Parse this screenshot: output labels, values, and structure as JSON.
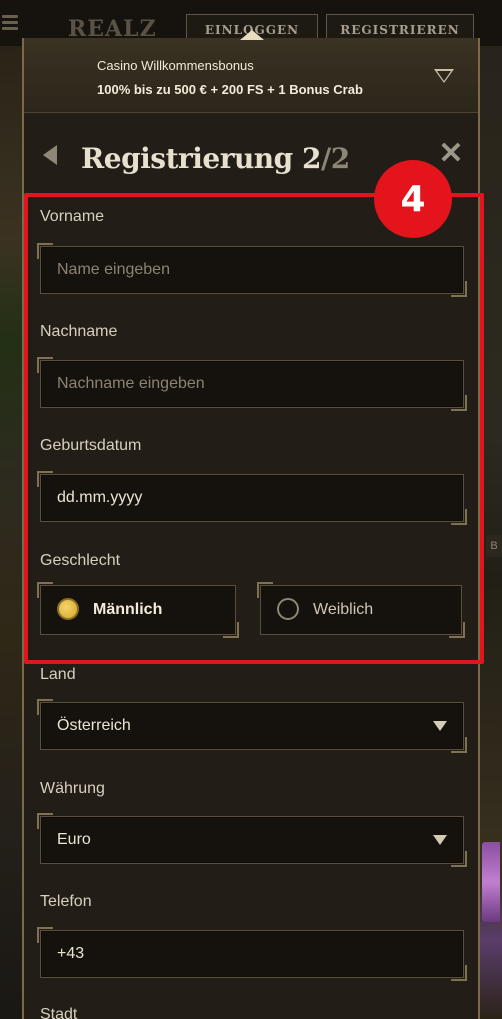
{
  "background": {
    "logo_text": "REALZ",
    "login_label": "EINLOGGEN",
    "register_label": "REGISTRIEREN",
    "right_tag": "B"
  },
  "bonus": {
    "title": "Casino Willkommensbonus",
    "text": "100% bis zu 500 € + 200 FS + 1 Bonus Crab"
  },
  "header": {
    "title": "Registrierung 2",
    "title_total": "/2"
  },
  "form": {
    "vorname": {
      "label": "Vorname",
      "placeholder": "Name eingeben"
    },
    "nachname": {
      "label": "Nachname",
      "placeholder": "Nachname eingeben"
    },
    "geburtsdatum": {
      "label": "Geburtsdatum",
      "value": "dd.mm.yyyy"
    },
    "geschlecht": {
      "label": "Geschlecht",
      "options": [
        {
          "label": "Männlich",
          "selected": true
        },
        {
          "label": "Weiblich",
          "selected": false
        }
      ]
    },
    "land": {
      "label": "Land",
      "value": "Österreich"
    },
    "waehrung": {
      "label": "Währung",
      "value": "Euro"
    },
    "telefon": {
      "label": "Telefon",
      "value": "+43"
    },
    "stadt": {
      "label": "Stadt"
    }
  },
  "annotation": {
    "step_number": "4",
    "color": "#e3141b"
  },
  "colors": {
    "accent_gold": "#d4a52a",
    "panel_bg": "#221d17",
    "field_bg": "#15110d"
  }
}
